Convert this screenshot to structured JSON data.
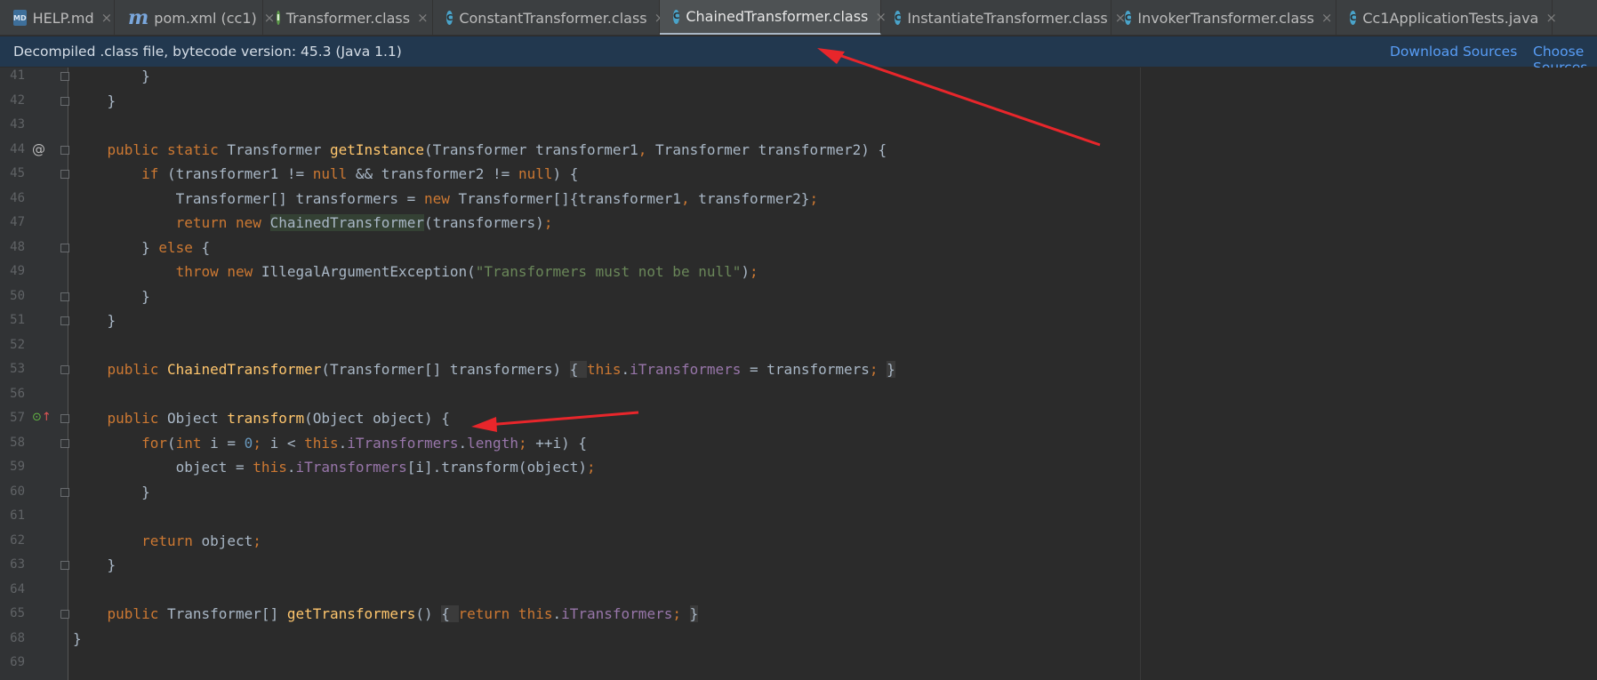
{
  "tabs": [
    {
      "icon": "markdown-file-icon",
      "glyph": "MD",
      "type": "md",
      "label": "HELP.md"
    },
    {
      "icon": "maven-file-icon",
      "glyph": "m",
      "type": "mvn",
      "label": "pom.xml (cc1)"
    },
    {
      "icon": "interface-file-icon",
      "glyph": "I",
      "type": "iface",
      "label": "Transformer.class"
    },
    {
      "icon": "class-file-icon",
      "glyph": "C",
      "type": "cls",
      "label": "ConstantTransformer.class"
    },
    {
      "icon": "class-file-icon",
      "glyph": "C",
      "type": "cls",
      "label": "ChainedTransformer.class",
      "active": true
    },
    {
      "icon": "class-file-icon",
      "glyph": "C",
      "type": "cls",
      "label": "InstantiateTransformer.class"
    },
    {
      "icon": "class-file-icon",
      "glyph": "C",
      "type": "cls",
      "label": "InvokerTransformer.class"
    },
    {
      "icon": "java-test-file-icon",
      "glyph": "C",
      "type": "java",
      "label": "Cc1ApplicationTests.java"
    }
  ],
  "close_glyph": "×",
  "banner": {
    "message": "Decompiled .class file, bytecode version: 45.3 (Java 1.1)",
    "download_sources": "Download Sources",
    "choose_sources": "Choose Sources..."
  },
  "gutter_marks": {
    "override": "@",
    "implemented": "⊙",
    "implemented_arrow": "↑"
  },
  "lines": [
    {
      "n": "41",
      "fold": "end",
      "tokens": [
        {
          "t": "        }",
          "c": ""
        }
      ]
    },
    {
      "n": "42",
      "fold": "end",
      "tokens": [
        {
          "t": "    }",
          "c": ""
        }
      ]
    },
    {
      "n": "43",
      "tokens": [
        {
          "t": "",
          "c": ""
        }
      ]
    },
    {
      "n": "44",
      "mark": "override",
      "fold": "start",
      "tokens": [
        {
          "t": "    ",
          "c": ""
        },
        {
          "t": "public static ",
          "c": "kw"
        },
        {
          "t": "Transformer ",
          "c": ""
        },
        {
          "t": "getInstance",
          "c": "fn"
        },
        {
          "t": "(Transformer transformer1",
          "c": ""
        },
        {
          "t": ", ",
          "c": "kw"
        },
        {
          "t": "Transformer transformer2) {",
          "c": ""
        }
      ]
    },
    {
      "n": "45",
      "fold": "start",
      "tokens": [
        {
          "t": "        ",
          "c": ""
        },
        {
          "t": "if ",
          "c": "kw"
        },
        {
          "t": "(transformer1 != ",
          "c": ""
        },
        {
          "t": "null ",
          "c": "kw"
        },
        {
          "t": "&& transformer2 != ",
          "c": ""
        },
        {
          "t": "null",
          "c": "kw"
        },
        {
          "t": ") {",
          "c": ""
        }
      ]
    },
    {
      "n": "46",
      "tokens": [
        {
          "t": "            Transformer[] transformers = ",
          "c": ""
        },
        {
          "t": "new ",
          "c": "kw"
        },
        {
          "t": "Transformer[]{transformer1",
          "c": ""
        },
        {
          "t": ", ",
          "c": "kw"
        },
        {
          "t": "transformer2}",
          "c": ""
        },
        {
          "t": ";",
          "c": "kw"
        }
      ]
    },
    {
      "n": "47",
      "tokens": [
        {
          "t": "            ",
          "c": ""
        },
        {
          "t": "return new ",
          "c": "kw"
        },
        {
          "t": "ChainedTransformer",
          "c": "ref"
        },
        {
          "t": "(transformers)",
          "c": ""
        },
        {
          "t": ";",
          "c": "kw"
        }
      ]
    },
    {
      "n": "48",
      "fold": "mid",
      "tokens": [
        {
          "t": "        } ",
          "c": ""
        },
        {
          "t": "else ",
          "c": "kw"
        },
        {
          "t": "{",
          "c": ""
        }
      ]
    },
    {
      "n": "49",
      "tokens": [
        {
          "t": "            ",
          "c": ""
        },
        {
          "t": "throw new ",
          "c": "kw"
        },
        {
          "t": "IllegalArgumentException(",
          "c": ""
        },
        {
          "t": "\"Transformers must not be null\"",
          "c": "str"
        },
        {
          "t": ")",
          "c": ""
        },
        {
          "t": ";",
          "c": "kw"
        }
      ]
    },
    {
      "n": "50",
      "fold": "end",
      "tokens": [
        {
          "t": "        }",
          "c": ""
        }
      ]
    },
    {
      "n": "51",
      "fold": "end",
      "tokens": [
        {
          "t": "    }",
          "c": ""
        }
      ]
    },
    {
      "n": "52",
      "tokens": [
        {
          "t": "",
          "c": ""
        }
      ]
    },
    {
      "n": "53",
      "fold": "box",
      "tokens": [
        {
          "t": "    ",
          "c": ""
        },
        {
          "t": "public ",
          "c": "kw"
        },
        {
          "t": "ChainedTransformer",
          "c": "fn"
        },
        {
          "t": "(Transformer[] transformers) ",
          "c": ""
        },
        {
          "t": "{ ",
          "c": "fb"
        },
        {
          "t": "this",
          "c": "kw"
        },
        {
          "t": ".",
          "c": ""
        },
        {
          "t": "iTransformers",
          "c": "fld"
        },
        {
          "t": " = transformers",
          "c": ""
        },
        {
          "t": "; ",
          "c": "kw"
        },
        {
          "t": "}",
          "c": "fb"
        }
      ]
    },
    {
      "n": "56",
      "tokens": [
        {
          "t": "",
          "c": ""
        }
      ]
    },
    {
      "n": "57",
      "mark": "implemented",
      "fold": "start",
      "tokens": [
        {
          "t": "    ",
          "c": ""
        },
        {
          "t": "public ",
          "c": "kw"
        },
        {
          "t": "Object ",
          "c": ""
        },
        {
          "t": "transform",
          "c": "fn"
        },
        {
          "t": "(Object object) {",
          "c": ""
        }
      ]
    },
    {
      "n": "58",
      "fold": "start",
      "tokens": [
        {
          "t": "        ",
          "c": ""
        },
        {
          "t": "for",
          "c": "kw"
        },
        {
          "t": "(",
          "c": ""
        },
        {
          "t": "int ",
          "c": "kw"
        },
        {
          "t": "i = ",
          "c": ""
        },
        {
          "t": "0",
          "c": "num"
        },
        {
          "t": "; ",
          "c": "kw"
        },
        {
          "t": "i < ",
          "c": ""
        },
        {
          "t": "this",
          "c": "kw"
        },
        {
          "t": ".",
          "c": ""
        },
        {
          "t": "iTransformers",
          "c": "fld"
        },
        {
          "t": ".",
          "c": ""
        },
        {
          "t": "length",
          "c": "fld"
        },
        {
          "t": "; ",
          "c": "kw"
        },
        {
          "t": "++i) {",
          "c": ""
        }
      ]
    },
    {
      "n": "59",
      "tokens": [
        {
          "t": "            object = ",
          "c": ""
        },
        {
          "t": "this",
          "c": "kw"
        },
        {
          "t": ".",
          "c": ""
        },
        {
          "t": "iTransformers",
          "c": "fld"
        },
        {
          "t": "[i].transform(object)",
          "c": ""
        },
        {
          "t": ";",
          "c": "kw"
        }
      ]
    },
    {
      "n": "60",
      "fold": "end",
      "tokens": [
        {
          "t": "        }",
          "c": ""
        }
      ]
    },
    {
      "n": "61",
      "tokens": [
        {
          "t": "",
          "c": ""
        }
      ]
    },
    {
      "n": "62",
      "tokens": [
        {
          "t": "        ",
          "c": ""
        },
        {
          "t": "return ",
          "c": "kw"
        },
        {
          "t": "object",
          "c": ""
        },
        {
          "t": ";",
          "c": "kw"
        }
      ]
    },
    {
      "n": "63",
      "fold": "end",
      "tokens": [
        {
          "t": "    }",
          "c": ""
        }
      ]
    },
    {
      "n": "64",
      "tokens": [
        {
          "t": "",
          "c": ""
        }
      ]
    },
    {
      "n": "65",
      "fold": "box",
      "tokens": [
        {
          "t": "    ",
          "c": ""
        },
        {
          "t": "public ",
          "c": "kw"
        },
        {
          "t": "Transformer[] ",
          "c": ""
        },
        {
          "t": "getTransformers",
          "c": "fn"
        },
        {
          "t": "() ",
          "c": ""
        },
        {
          "t": "{ ",
          "c": "fb"
        },
        {
          "t": "return this",
          "c": "kw"
        },
        {
          "t": ".",
          "c": ""
        },
        {
          "t": "iTransformers",
          "c": "fld"
        },
        {
          "t": "; ",
          "c": "kw"
        },
        {
          "t": "}",
          "c": "fb"
        }
      ]
    },
    {
      "n": "68",
      "tokens": [
        {
          "t": "}",
          "c": ""
        }
      ]
    },
    {
      "n": "69",
      "tokens": [
        {
          "t": "",
          "c": ""
        }
      ]
    }
  ],
  "colors": {
    "editor_bg": "#2b2b2b",
    "gutter_bg": "#313335",
    "banner_bg": "#22384f",
    "link": "#589df6",
    "annotation_arrow": "#e8262b"
  }
}
